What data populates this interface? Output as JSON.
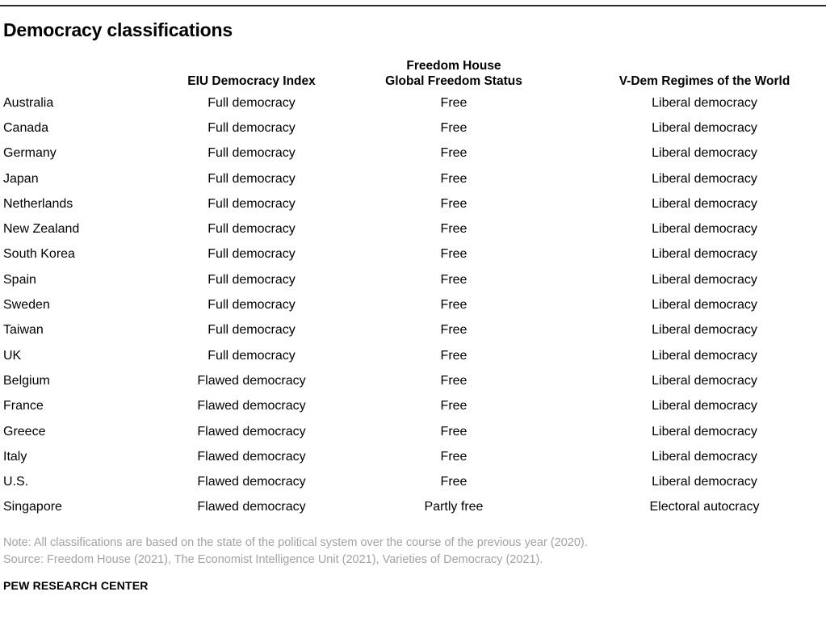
{
  "title": "Democracy classifications",
  "table": {
    "columns": [
      {
        "key": "country",
        "label": ""
      },
      {
        "key": "eiu",
        "label": "EIU Democracy Index"
      },
      {
        "key": "fh",
        "label_line1": "Freedom House",
        "label_line2": "Global Freedom Status"
      },
      {
        "key": "vdem",
        "label": "V-Dem Regimes of the World"
      }
    ],
    "rows": [
      {
        "country": "Australia",
        "eiu": "Full democracy",
        "fh": "Free",
        "vdem": "Liberal democracy"
      },
      {
        "country": "Canada",
        "eiu": "Full democracy",
        "fh": "Free",
        "vdem": "Liberal democracy"
      },
      {
        "country": "Germany",
        "eiu": "Full democracy",
        "fh": "Free",
        "vdem": "Liberal democracy"
      },
      {
        "country": "Japan",
        "eiu": "Full democracy",
        "fh": "Free",
        "vdem": "Liberal democracy"
      },
      {
        "country": "Netherlands",
        "eiu": "Full democracy",
        "fh": "Free",
        "vdem": "Liberal democracy"
      },
      {
        "country": "New Zealand",
        "eiu": "Full democracy",
        "fh": "Free",
        "vdem": "Liberal democracy"
      },
      {
        "country": "South Korea",
        "eiu": "Full democracy",
        "fh": "Free",
        "vdem": "Liberal democracy"
      },
      {
        "country": "Spain",
        "eiu": "Full democracy",
        "fh": "Free",
        "vdem": "Liberal democracy"
      },
      {
        "country": "Sweden",
        "eiu": "Full democracy",
        "fh": "Free",
        "vdem": "Liberal democracy"
      },
      {
        "country": "Taiwan",
        "eiu": "Full democracy",
        "fh": "Free",
        "vdem": "Liberal democracy"
      },
      {
        "country": "UK",
        "eiu": "Full democracy",
        "fh": "Free",
        "vdem": "Liberal democracy"
      },
      {
        "country": "Belgium",
        "eiu": "Flawed democracy",
        "fh": "Free",
        "vdem": "Liberal democracy"
      },
      {
        "country": "France",
        "eiu": "Flawed democracy",
        "fh": "Free",
        "vdem": "Liberal democracy"
      },
      {
        "country": "Greece",
        "eiu": "Flawed democracy",
        "fh": "Free",
        "vdem": "Liberal democracy"
      },
      {
        "country": "Italy",
        "eiu": "Flawed democracy",
        "fh": "Free",
        "vdem": "Liberal democracy"
      },
      {
        "country": "U.S.",
        "eiu": "Flawed democracy",
        "fh": "Free",
        "vdem": "Liberal democracy"
      },
      {
        "country": "Singapore",
        "eiu": "Flawed democracy",
        "fh": "Partly free",
        "vdem": "Electoral autocracy"
      }
    ]
  },
  "note": "Note: All classifications are based on the state of the political system over the course of the previous year (2020).",
  "source": "Source: Freedom House (2021), The Economist Intelligence Unit (2021), Varieties of Democracy (2021).",
  "footer": "PEW RESEARCH CENTER",
  "colors": {
    "rule": "#2b2b2b",
    "text": "#000000",
    "footnote": "#a2a2a7"
  },
  "chart_data": {
    "type": "table",
    "title": "Democracy classifications",
    "columns": [
      "",
      "EIU Democracy Index",
      "Freedom House Global Freedom Status",
      "V-Dem Regimes of the World"
    ],
    "rows": [
      [
        "Australia",
        "Full democracy",
        "Free",
        "Liberal democracy"
      ],
      [
        "Canada",
        "Full democracy",
        "Free",
        "Liberal democracy"
      ],
      [
        "Germany",
        "Full democracy",
        "Free",
        "Liberal democracy"
      ],
      [
        "Japan",
        "Full democracy",
        "Free",
        "Liberal democracy"
      ],
      [
        "Netherlands",
        "Full democracy",
        "Free",
        "Liberal democracy"
      ],
      [
        "New Zealand",
        "Full democracy",
        "Free",
        "Liberal democracy"
      ],
      [
        "South Korea",
        "Full democracy",
        "Free",
        "Liberal democracy"
      ],
      [
        "Spain",
        "Full democracy",
        "Free",
        "Liberal democracy"
      ],
      [
        "Sweden",
        "Full democracy",
        "Free",
        "Liberal democracy"
      ],
      [
        "Taiwan",
        "Full democracy",
        "Free",
        "Liberal democracy"
      ],
      [
        "UK",
        "Full democracy",
        "Free",
        "Liberal democracy"
      ],
      [
        "Belgium",
        "Flawed democracy",
        "Free",
        "Liberal democracy"
      ],
      [
        "France",
        "Flawed democracy",
        "Free",
        "Liberal democracy"
      ],
      [
        "Greece",
        "Flawed democracy",
        "Free",
        "Liberal democracy"
      ],
      [
        "Italy",
        "Flawed democracy",
        "Free",
        "Liberal democracy"
      ],
      [
        "U.S.",
        "Flawed democracy",
        "Free",
        "Liberal democracy"
      ],
      [
        "Singapore",
        "Flawed democracy",
        "Partly free",
        "Electoral autocracy"
      ]
    ],
    "note": "Note: All classifications are based on the state of the political system over the course of the previous year (2020).",
    "source": "Source: Freedom House (2021), The Economist Intelligence Unit (2021), Varieties of Democracy (2021)."
  }
}
